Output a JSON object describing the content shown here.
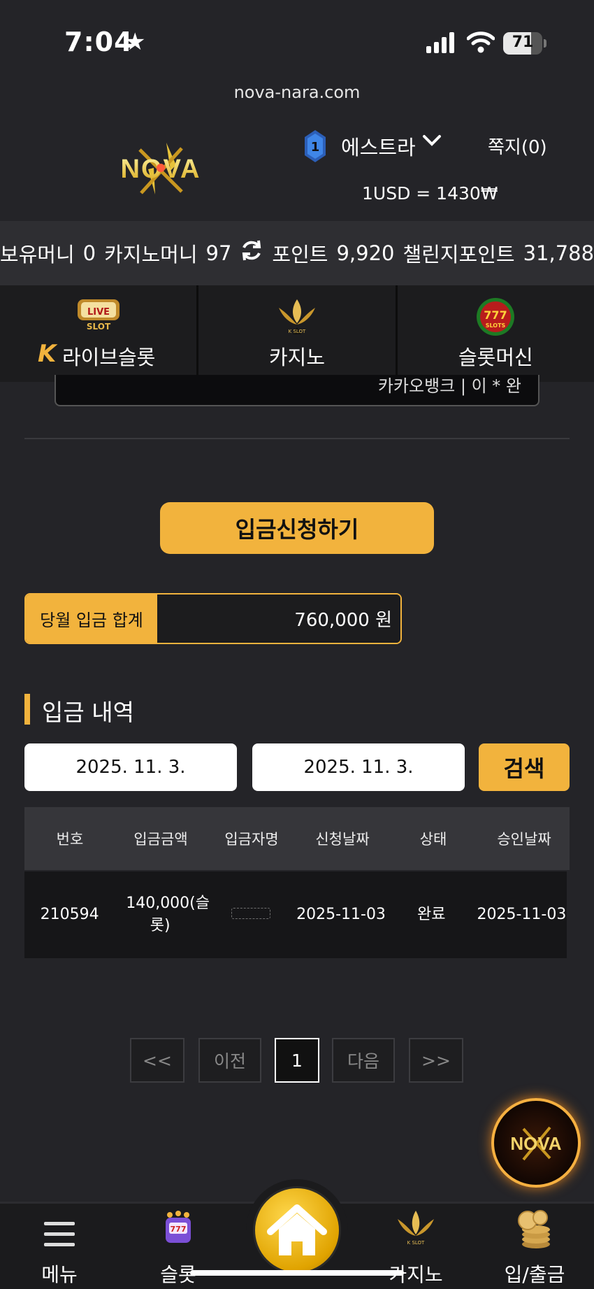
{
  "status_bar": {
    "time": "7:04",
    "battery": "71",
    "battery_level": 0.71
  },
  "url": "nova-nara.com",
  "header": {
    "logo_text": "NOVA",
    "rank": "1",
    "username": "에스트라",
    "memo": "쪽지(0)",
    "exchange_rate": "1USD = 1430₩"
  },
  "balance": {
    "holding_label": "보유머니",
    "holding_value": "0",
    "casino_label": "카지노머니",
    "casino_value": "97",
    "point_label": "포인트",
    "point_value": "9,920",
    "challenge_label": "챌린지포인트",
    "challenge_value": "31,788"
  },
  "tabs": [
    {
      "label": "라이브슬롯",
      "icon_text": "LIVE SLOT"
    },
    {
      "label": "카지노",
      "icon_text": "K SLOT"
    },
    {
      "label": "슬롯머신",
      "icon_text": "777 SLOTS"
    }
  ],
  "account_box": {
    "text": "카카오뱅크 | 이 * 완"
  },
  "deposit_button": "입금신청하기",
  "monthly_total": {
    "label": "당월 입금 합계",
    "value": "760,000 원"
  },
  "history": {
    "title": "입금 내역",
    "date_from": "2025. 11. 3.",
    "date_to": "2025. 11. 3.",
    "search_label": "검색",
    "columns": [
      "번호",
      "입금금액",
      "입금자명",
      "신청날짜",
      "상태",
      "승인날짜"
    ],
    "rows": [
      {
        "no": "210594",
        "amount": "140,000(슬롯)",
        "depositor": "",
        "request_date": "2025-11-03",
        "status": "완료",
        "approve_date": "2025-11-03"
      }
    ]
  },
  "pagination": {
    "first": "<<",
    "prev": "이전",
    "current": "1",
    "next": "다음",
    "last": ">>"
  },
  "bottom_nav": {
    "menu": "메뉴",
    "slot": "슬롯",
    "casino": "카지노",
    "deposit": "입/출금"
  },
  "colors": {
    "accent": "#f2b33d",
    "background": "#242428"
  }
}
